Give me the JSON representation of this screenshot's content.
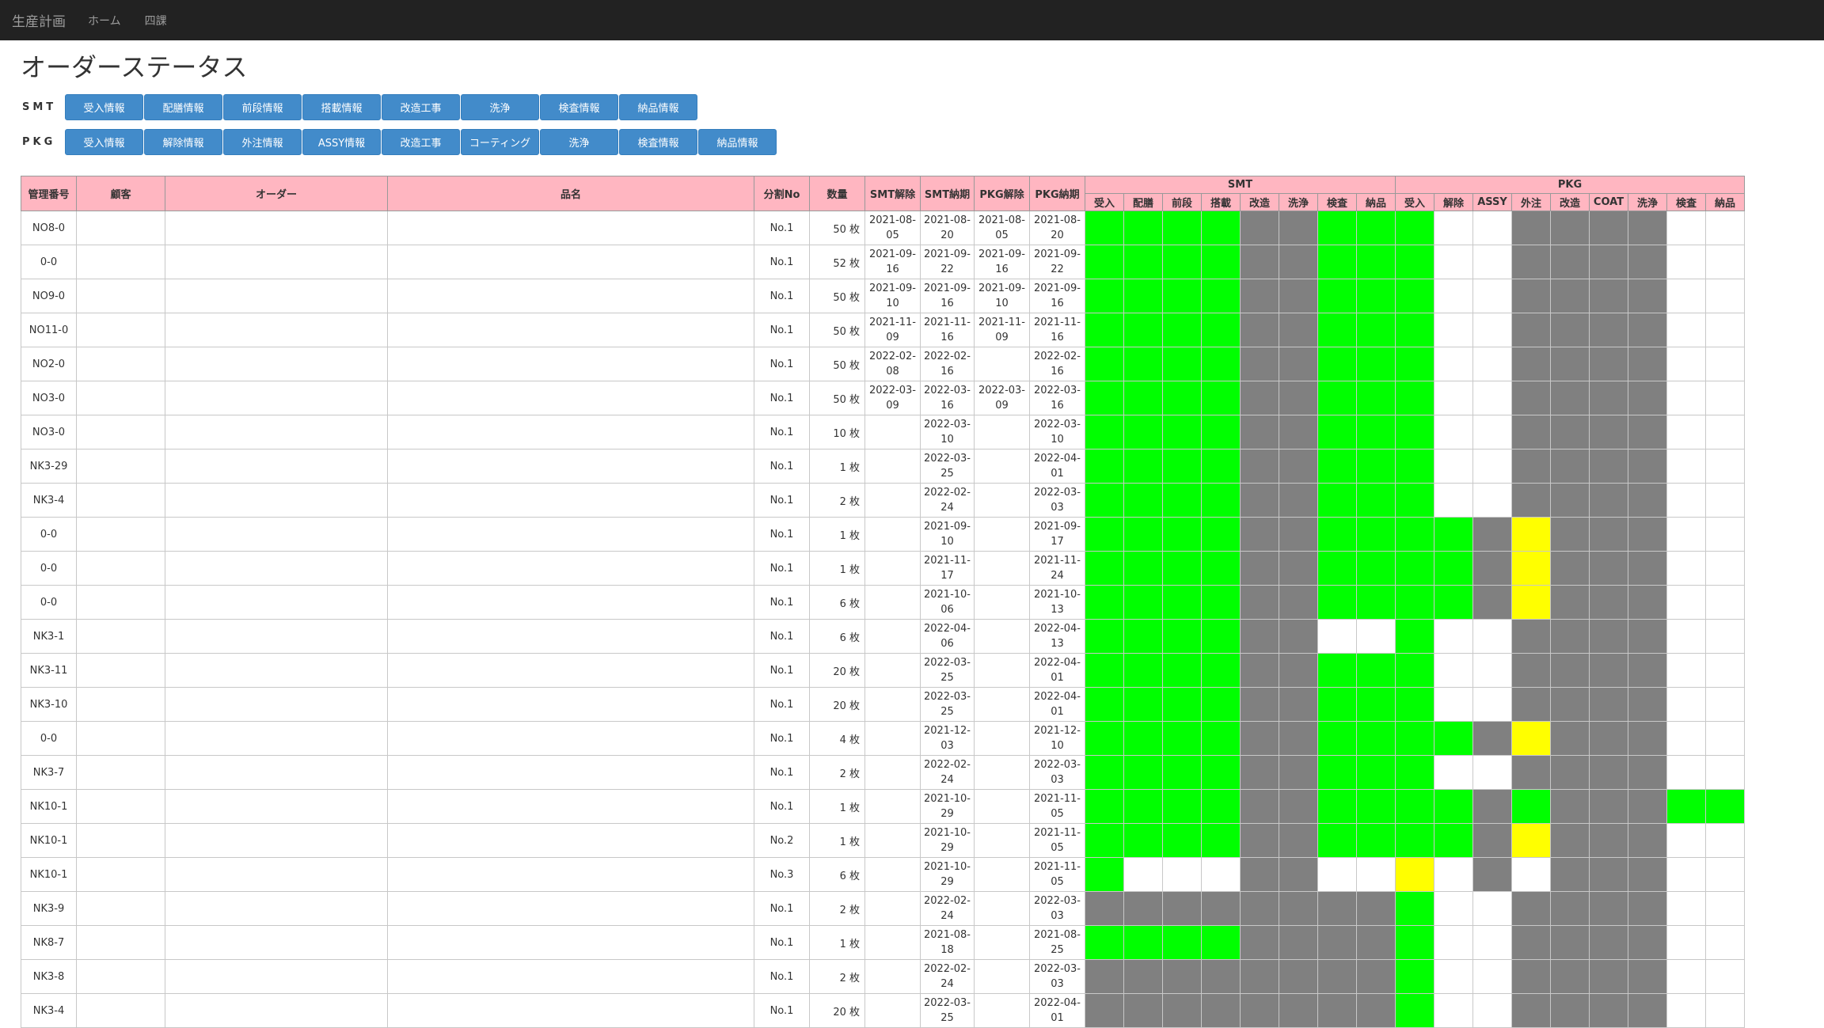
{
  "nav": {
    "brand": "生産計画",
    "links": [
      "ホーム",
      "四課"
    ]
  },
  "page": {
    "title": "オーダーステータス"
  },
  "buttons": {
    "smt": {
      "label": "SMT",
      "items": [
        "受入情報",
        "配膳情報",
        "前段情報",
        "搭載情報",
        "改造工事",
        "洗浄",
        "検査情報",
        "納品情報"
      ]
    },
    "pkg": {
      "label": "PKG",
      "items": [
        "受入情報",
        "解除情報",
        "外注情報",
        "ASSY情報",
        "改造工事",
        "コーティング",
        "洗浄",
        "検査情報",
        "納品情報"
      ]
    }
  },
  "table": {
    "headers": [
      "管理番号",
      "顧客",
      "オーダー",
      "品名",
      "分割No",
      "数量",
      "SMT解除",
      "SMT納期",
      "PKG解除",
      "PKG納期"
    ],
    "smt_group": "SMT",
    "pkg_group": "PKG",
    "smt_stages": [
      "受入",
      "配膳",
      "前段",
      "搭載",
      "改造",
      "洗浄",
      "検査",
      "納品"
    ],
    "pkg_stages": [
      "受入",
      "解除",
      "ASSY",
      "外注",
      "改造",
      "COAT",
      "洗浄",
      "検査",
      "納品"
    ],
    "status_colors": {
      "G": "#00ff00",
      "R": "#808080",
      "Y": "#ffff00",
      "W": "#ffffff"
    },
    "rows": [
      {
        "id": "NO8-0",
        "customer": "",
        "order": "",
        "product": "",
        "split": "No.1",
        "qty": "50 枚",
        "smt_release": "2021-08-05",
        "smt_due": "2021-08-20",
        "pkg_release": "2021-08-05",
        "pkg_due": "2021-08-20",
        "smt": "GGGGRRGG",
        "pkg": "GWWRRRRWW"
      },
      {
        "id": "0-0",
        "customer": "",
        "order": "",
        "product": "",
        "split": "No.1",
        "qty": "52 枚",
        "smt_release": "2021-09-16",
        "smt_due": "2021-09-22",
        "pkg_release": "2021-09-16",
        "pkg_due": "2021-09-22",
        "smt": "GGGGRRGG",
        "pkg": "GWWRRRRWW"
      },
      {
        "id": "NO9-0",
        "customer": "",
        "order": "",
        "product": "",
        "split": "No.1",
        "qty": "50 枚",
        "smt_release": "2021-09-10",
        "smt_due": "2021-09-16",
        "pkg_release": "2021-09-10",
        "pkg_due": "2021-09-16",
        "smt": "GGGGRRGG",
        "pkg": "GWWRRRRWW"
      },
      {
        "id": "NO11-0",
        "customer": "",
        "order": "",
        "product": "",
        "split": "No.1",
        "qty": "50 枚",
        "smt_release": "2021-11-09",
        "smt_due": "2021-11-16",
        "pkg_release": "2021-11-09",
        "pkg_due": "2021-11-16",
        "smt": "GGGGRRGG",
        "pkg": "GWWRRRRWW"
      },
      {
        "id": "NO2-0",
        "customer": "",
        "order": "",
        "product": "",
        "split": "No.1",
        "qty": "50 枚",
        "smt_release": "2022-02-08",
        "smt_due": "2022-02-16",
        "pkg_release": "",
        "pkg_due": "2022-02-16",
        "smt": "GGGGRRGG",
        "pkg": "GWWRRRRWW"
      },
      {
        "id": "NO3-0",
        "customer": "",
        "order": "",
        "product": "",
        "split": "No.1",
        "qty": "50 枚",
        "smt_release": "2022-03-09",
        "smt_due": "2022-03-16",
        "pkg_release": "2022-03-09",
        "pkg_due": "2022-03-16",
        "smt": "GGGGRRGG",
        "pkg": "GWWRRRRWW"
      },
      {
        "id": "NO3-0",
        "customer": "",
        "order": "",
        "product": "",
        "split": "No.1",
        "qty": "10 枚",
        "smt_release": "",
        "smt_due": "2022-03-10",
        "pkg_release": "",
        "pkg_due": "2022-03-10",
        "smt": "GGGGRRGG",
        "pkg": "GWWRRRRWW"
      },
      {
        "id": "NK3-29",
        "customer": "",
        "order": "",
        "product": "",
        "split": "No.1",
        "qty": "1 枚",
        "smt_release": "",
        "smt_due": "2022-03-25",
        "pkg_release": "",
        "pkg_due": "2022-04-01",
        "smt": "GGGGRRGG",
        "pkg": "GWWRRRRWW"
      },
      {
        "id": "NK3-4",
        "customer": "",
        "order": "",
        "product": "",
        "split": "No.1",
        "qty": "2 枚",
        "smt_release": "",
        "smt_due": "2022-02-24",
        "pkg_release": "",
        "pkg_due": "2022-03-03",
        "smt": "GGGGRRGG",
        "pkg": "GWWRRRRWW"
      },
      {
        "id": "0-0",
        "customer": "",
        "order": "",
        "product": "",
        "split": "No.1",
        "qty": "1 枚",
        "smt_release": "",
        "smt_due": "2021-09-10",
        "pkg_release": "",
        "pkg_due": "2021-09-17",
        "smt": "GGGGRRGG",
        "pkg": "GGRYRRRWW"
      },
      {
        "id": "0-0",
        "customer": "",
        "order": "",
        "product": "",
        "split": "No.1",
        "qty": "1 枚",
        "smt_release": "",
        "smt_due": "2021-11-17",
        "pkg_release": "",
        "pkg_due": "2021-11-24",
        "smt": "GGGGRRGG",
        "pkg": "GGRYRRRWW"
      },
      {
        "id": "0-0",
        "customer": "",
        "order": "",
        "product": "",
        "split": "No.1",
        "qty": "6 枚",
        "smt_release": "",
        "smt_due": "2021-10-06",
        "pkg_release": "",
        "pkg_due": "2021-10-13",
        "smt": "GGGGRRGG",
        "pkg": "GGRYRRRWW"
      },
      {
        "id": "NK3-1",
        "customer": "",
        "order": "",
        "product": "",
        "split": "No.1",
        "qty": "6 枚",
        "smt_release": "",
        "smt_due": "2022-04-06",
        "pkg_release": "",
        "pkg_due": "2022-04-13",
        "smt": "GGGGRRWW",
        "pkg": "GWWRRRRWW"
      },
      {
        "id": "NK3-11",
        "customer": "",
        "order": "",
        "product": "",
        "split": "No.1",
        "qty": "20 枚",
        "smt_release": "",
        "smt_due": "2022-03-25",
        "pkg_release": "",
        "pkg_due": "2022-04-01",
        "smt": "GGGGRRGG",
        "pkg": "GWWRRRRWW"
      },
      {
        "id": "NK3-10",
        "customer": "",
        "order": "",
        "product": "",
        "split": "No.1",
        "qty": "20 枚",
        "smt_release": "",
        "smt_due": "2022-03-25",
        "pkg_release": "",
        "pkg_due": "2022-04-01",
        "smt": "GGGGRRGG",
        "pkg": "GWWRRRRWW"
      },
      {
        "id": "0-0",
        "customer": "",
        "order": "",
        "product": "",
        "split": "No.1",
        "qty": "4 枚",
        "smt_release": "",
        "smt_due": "2021-12-03",
        "pkg_release": "",
        "pkg_due": "2021-12-10",
        "smt": "GGGGRRGG",
        "pkg": "GGRYRRRWW"
      },
      {
        "id": "NK3-7",
        "customer": "",
        "order": "",
        "product": "",
        "split": "No.1",
        "qty": "2 枚",
        "smt_release": "",
        "smt_due": "2022-02-24",
        "pkg_release": "",
        "pkg_due": "2022-03-03",
        "smt": "GGGGRRGG",
        "pkg": "GWWRRRRWW"
      },
      {
        "id": "NK10-1",
        "customer": "",
        "order": "",
        "product": "",
        "split": "No.1",
        "qty": "1 枚",
        "smt_release": "",
        "smt_due": "2021-10-29",
        "pkg_release": "",
        "pkg_due": "2021-11-05",
        "smt": "GGGGRRGG",
        "pkg": "GGRGRRRGG"
      },
      {
        "id": "NK10-1",
        "customer": "",
        "order": "",
        "product": "",
        "split": "No.2",
        "qty": "1 枚",
        "smt_release": "",
        "smt_due": "2021-10-29",
        "pkg_release": "",
        "pkg_due": "2021-11-05",
        "smt": "GGGGRRGG",
        "pkg": "GGRYRRRWW"
      },
      {
        "id": "NK10-1",
        "customer": "",
        "order": "",
        "product": "",
        "split": "No.3",
        "qty": "6 枚",
        "smt_release": "",
        "smt_due": "2021-10-29",
        "pkg_release": "",
        "pkg_due": "2021-11-05",
        "smt": "GWWWRRWW",
        "pkg": "YWRWRRRWW"
      },
      {
        "id": "NK3-9",
        "customer": "",
        "order": "",
        "product": "",
        "split": "No.1",
        "qty": "2 枚",
        "smt_release": "",
        "smt_due": "2022-02-24",
        "pkg_release": "",
        "pkg_due": "2022-03-03",
        "smt": "RRRRRRRR",
        "pkg": "GWWRRRRWW"
      },
      {
        "id": "NK8-7",
        "customer": "",
        "order": "",
        "product": "",
        "split": "No.1",
        "qty": "1 枚",
        "smt_release": "",
        "smt_due": "2021-08-18",
        "pkg_release": "",
        "pkg_due": "2021-08-25",
        "smt": "GGGGRRRR",
        "pkg": "GWWRRRRWW"
      },
      {
        "id": "NK3-8",
        "customer": "",
        "order": "",
        "product": "",
        "split": "No.1",
        "qty": "2 枚",
        "smt_release": "",
        "smt_due": "2022-02-24",
        "pkg_release": "",
        "pkg_due": "2022-03-03",
        "smt": "RRRRRRRR",
        "pkg": "GWWRRRRWW"
      },
      {
        "id": "NK3-4",
        "customer": "",
        "order": "",
        "product": "",
        "split": "No.1",
        "qty": "20 枚",
        "smt_release": "",
        "smt_due": "2022-03-25",
        "pkg_release": "",
        "pkg_due": "2022-04-01",
        "smt": "RRRRRRRR",
        "pkg": "GWWRRRRWW"
      }
    ]
  }
}
